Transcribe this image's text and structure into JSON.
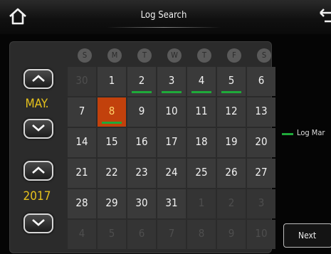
{
  "header": {
    "title": "Log Search",
    "home_icon": "home-icon",
    "back_icon": "back-arrow-icon"
  },
  "month_selector": {
    "value": "MAY.",
    "up_icon": "chevron-up-icon",
    "down_icon": "chevron-down-icon"
  },
  "year_selector": {
    "value": "2017",
    "up_icon": "chevron-up-icon",
    "down_icon": "chevron-down-icon"
  },
  "weekdays": [
    "S",
    "M",
    "T",
    "W",
    "T",
    "F",
    "S"
  ],
  "calendar": {
    "selected_day": "8",
    "weeks": [
      [
        {
          "d": "30",
          "dim": true
        },
        {
          "d": "1"
        },
        {
          "d": "2",
          "mark": true
        },
        {
          "d": "3",
          "mark": true
        },
        {
          "d": "4",
          "mark": true
        },
        {
          "d": "5",
          "mark": true
        },
        {
          "d": "6"
        }
      ],
      [
        {
          "d": "7"
        },
        {
          "d": "8",
          "mark": true,
          "sel": true
        },
        {
          "d": "9"
        },
        {
          "d": "10"
        },
        {
          "d": "11"
        },
        {
          "d": "12"
        },
        {
          "d": "13"
        }
      ],
      [
        {
          "d": "14"
        },
        {
          "d": "15"
        },
        {
          "d": "16"
        },
        {
          "d": "17"
        },
        {
          "d": "18"
        },
        {
          "d": "19"
        },
        {
          "d": "20"
        }
      ],
      [
        {
          "d": "21"
        },
        {
          "d": "22"
        },
        {
          "d": "23"
        },
        {
          "d": "24"
        },
        {
          "d": "25"
        },
        {
          "d": "26"
        },
        {
          "d": "27"
        }
      ],
      [
        {
          "d": "28"
        },
        {
          "d": "29"
        },
        {
          "d": "30"
        },
        {
          "d": "31"
        },
        {
          "d": "1",
          "dim": true
        },
        {
          "d": "2",
          "dim": true
        },
        {
          "d": "3",
          "dim": true
        }
      ],
      [
        {
          "d": "4",
          "dim": true
        },
        {
          "d": "5",
          "dim": true
        },
        {
          "d": "6",
          "dim": true
        },
        {
          "d": "7",
          "dim": true
        },
        {
          "d": "8",
          "dim": true
        },
        {
          "d": "9",
          "dim": true
        },
        {
          "d": "10",
          "dim": true
        }
      ]
    ]
  },
  "legend": {
    "label": "Log Mar",
    "color": "#1faa3a"
  },
  "footer": {
    "next_label": "Next"
  },
  "colors": {
    "accent_yellow": "#e6c21c",
    "selected": "#c2410c",
    "mark": "#1faa3a"
  }
}
